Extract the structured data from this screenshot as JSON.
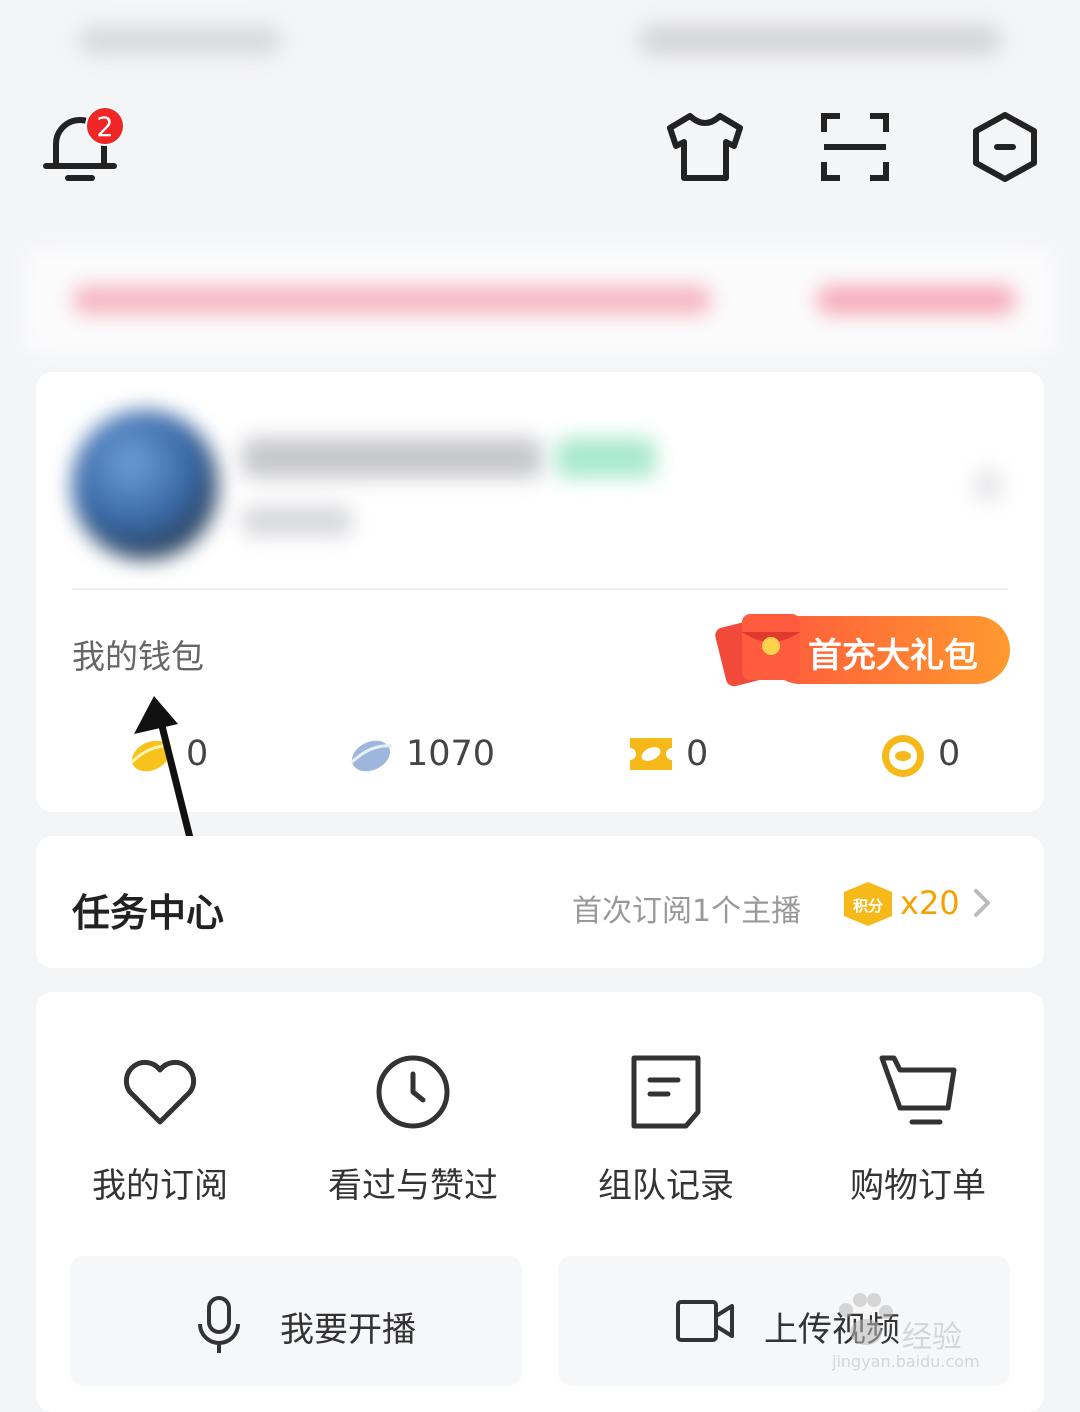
{
  "header": {
    "notification_count": "2"
  },
  "wallet": {
    "title": "我的钱包",
    "promo_button": "首充大礼包",
    "balances": [
      {
        "icon": "gold-bean-icon",
        "value": "0"
      },
      {
        "icon": "silver-bean-icon",
        "value": "1070"
      },
      {
        "icon": "ticket-icon",
        "value": "0"
      },
      {
        "icon": "coin-icon",
        "value": "0"
      }
    ]
  },
  "task_center": {
    "title": "任务中心",
    "description": "首次订阅1个主播",
    "points_label": "积分",
    "reward": "x20"
  },
  "features": {
    "items": [
      {
        "label": "我的订阅",
        "icon": "heart-icon"
      },
      {
        "label": "看过与赞过",
        "icon": "clock-icon"
      },
      {
        "label": "组队记录",
        "icon": "note-icon"
      },
      {
        "label": "购物订单",
        "icon": "cart-icon"
      }
    ],
    "start_live": "我要开播",
    "upload_video": "上传视频"
  },
  "watermark": {
    "text": "经验",
    "url": "jingyan.baidu.com"
  },
  "colors": {
    "accent": "#ff6a35",
    "badge": "#f02525",
    "points": "#f5a100"
  }
}
